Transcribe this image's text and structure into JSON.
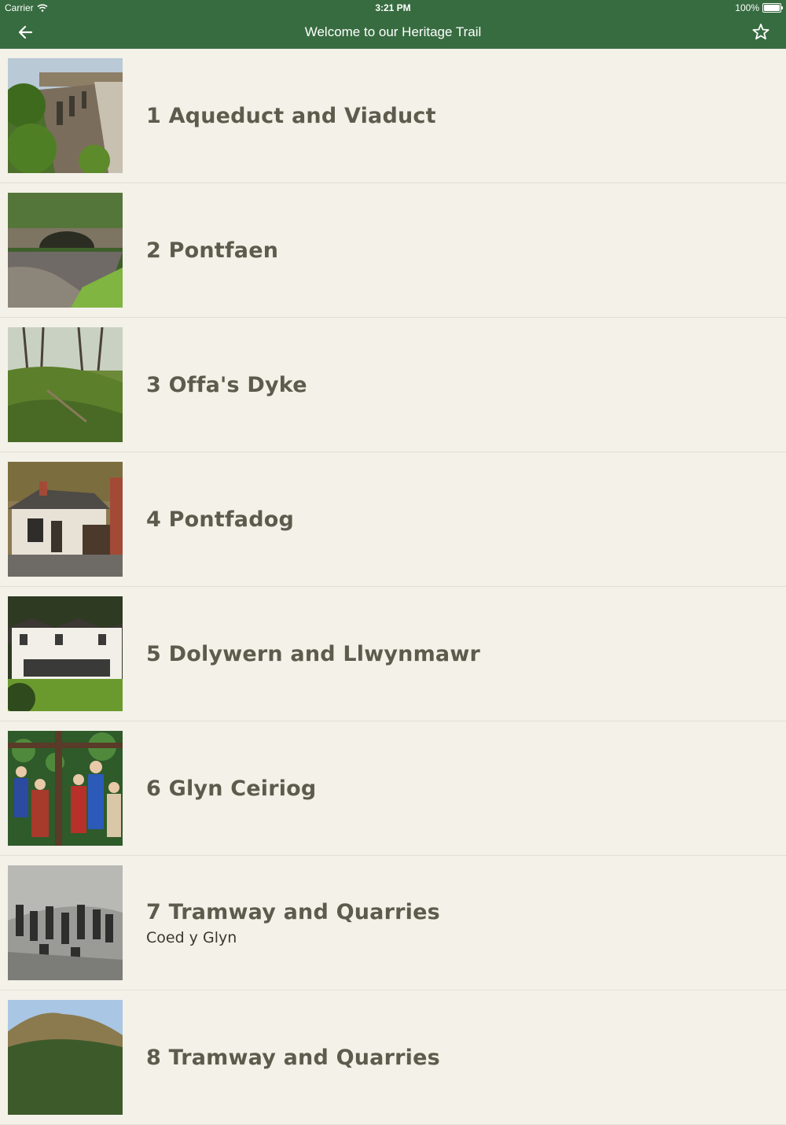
{
  "status_bar": {
    "carrier": "Carrier",
    "time": "3:21 PM",
    "battery": "100%"
  },
  "nav": {
    "title": "Welcome to our Heritage Trail",
    "back_icon": "arrow-left-icon",
    "favorite_icon": "star-outline-icon"
  },
  "colors": {
    "header": "#376c40",
    "background": "#f3f1e8",
    "title_text": "#5e5b4d"
  },
  "items": [
    {
      "title": "1 Aqueduct and Viaduct",
      "subtitle": "",
      "image": "aqueduct-photo"
    },
    {
      "title": "2 Pontfaen",
      "subtitle": "",
      "image": "stone-bridge-river-photo"
    },
    {
      "title": "3 Offa's Dyke",
      "subtitle": "",
      "image": "grassy-bank-trees-photo"
    },
    {
      "title": "4 Pontfadog",
      "subtitle": "",
      "image": "cottage-photo"
    },
    {
      "title": "5 Dolywern and Llwynmawr",
      "subtitle": "",
      "image": "white-house-photo"
    },
    {
      "title": "6 Glyn Ceiriog",
      "subtitle": "",
      "image": "stained-glass-photo"
    },
    {
      "title": "7 Tramway and Quarries",
      "subtitle": "Coed y Glyn",
      "image": "quarry-workers-photo"
    },
    {
      "title": "8 Tramway and Quarries",
      "subtitle": "",
      "image": "hillside-forest-photo"
    }
  ]
}
